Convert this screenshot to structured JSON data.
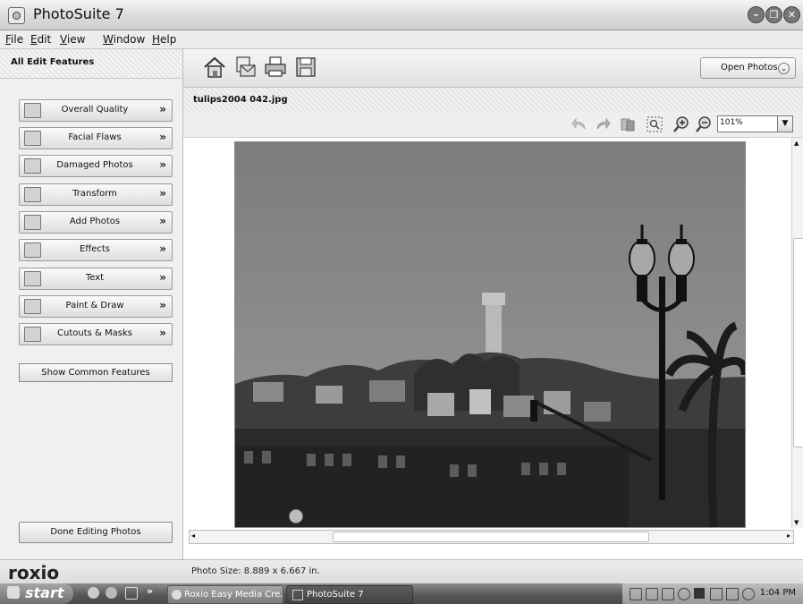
{
  "window": {
    "title": "PhotoSuite 7",
    "controls": [
      "minimize",
      "restore",
      "close"
    ]
  },
  "menubar": [
    "File",
    "Edit",
    "View",
    "Window",
    "Help"
  ],
  "left_panel": {
    "header": "All Edit Features",
    "features": [
      {
        "label": "Overall Quality",
        "icon": "quality-icon"
      },
      {
        "label": "Facial Flaws",
        "icon": "face-icon"
      },
      {
        "label": "Damaged Photos",
        "icon": "damaged-photo-icon"
      },
      {
        "label": "Transform",
        "icon": "transform-icon"
      },
      {
        "label": "Add Photos",
        "icon": "add-photo-icon"
      },
      {
        "label": "Effects",
        "icon": "effects-icon"
      },
      {
        "label": "Text",
        "icon": "text-icon"
      },
      {
        "label": "Paint & Draw",
        "icon": "paint-icon"
      },
      {
        "label": "Cutouts & Masks",
        "icon": "cutout-icon"
      }
    ],
    "chevron": "»",
    "show_common": "Show Common Features",
    "done": "Done Editing Photos"
  },
  "toolbar": {
    "tools": [
      "home-icon",
      "email-icon",
      "print-icon",
      "save-icon"
    ],
    "open_photos": "Open Photos"
  },
  "document": {
    "title": "tulips2004 042.jpg",
    "view_tools": [
      "undo-icon",
      "redo-icon",
      "compare-icon",
      "zoom-to-fit-icon",
      "zoom-in-icon",
      "zoom-out-icon"
    ],
    "zoom": "101%"
  },
  "status": {
    "logo": "roxio",
    "photo_size": "Photo Size: 8.889 x 6.667 in."
  },
  "taskbar": {
    "start": "start",
    "chevron": "»",
    "tasks": [
      {
        "label": "Roxio Easy Media Cre...",
        "active": false
      },
      {
        "label": "PhotoSuite 7",
        "active": true
      }
    ],
    "clock": "1:04 PM"
  }
}
